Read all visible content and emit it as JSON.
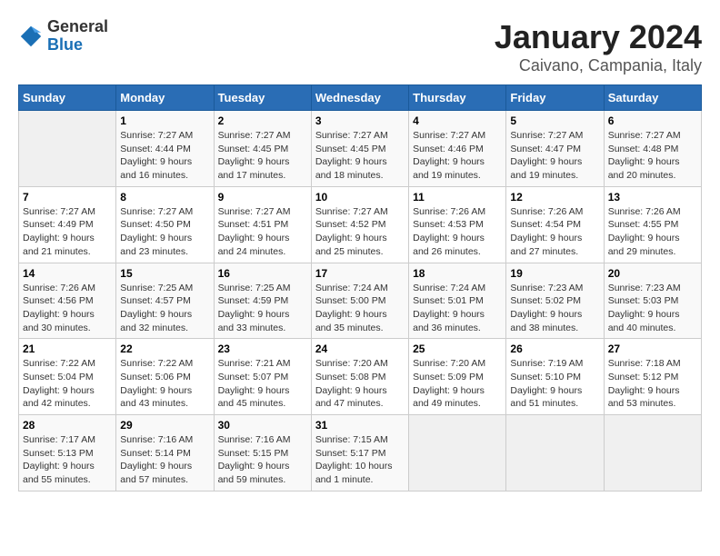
{
  "logo": {
    "general": "General",
    "blue": "Blue"
  },
  "title": "January 2024",
  "subtitle": "Caivano, Campania, Italy",
  "days_of_week": [
    "Sunday",
    "Monday",
    "Tuesday",
    "Wednesday",
    "Thursday",
    "Friday",
    "Saturday"
  ],
  "weeks": [
    [
      {
        "day": "",
        "sunrise": "",
        "sunset": "",
        "daylight": ""
      },
      {
        "day": "1",
        "sunrise": "Sunrise: 7:27 AM",
        "sunset": "Sunset: 4:44 PM",
        "daylight": "Daylight: 9 hours and 16 minutes."
      },
      {
        "day": "2",
        "sunrise": "Sunrise: 7:27 AM",
        "sunset": "Sunset: 4:45 PM",
        "daylight": "Daylight: 9 hours and 17 minutes."
      },
      {
        "day": "3",
        "sunrise": "Sunrise: 7:27 AM",
        "sunset": "Sunset: 4:45 PM",
        "daylight": "Daylight: 9 hours and 18 minutes."
      },
      {
        "day": "4",
        "sunrise": "Sunrise: 7:27 AM",
        "sunset": "Sunset: 4:46 PM",
        "daylight": "Daylight: 9 hours and 19 minutes."
      },
      {
        "day": "5",
        "sunrise": "Sunrise: 7:27 AM",
        "sunset": "Sunset: 4:47 PM",
        "daylight": "Daylight: 9 hours and 19 minutes."
      },
      {
        "day": "6",
        "sunrise": "Sunrise: 7:27 AM",
        "sunset": "Sunset: 4:48 PM",
        "daylight": "Daylight: 9 hours and 20 minutes."
      }
    ],
    [
      {
        "day": "7",
        "sunrise": "Sunrise: 7:27 AM",
        "sunset": "Sunset: 4:49 PM",
        "daylight": "Daylight: 9 hours and 21 minutes."
      },
      {
        "day": "8",
        "sunrise": "Sunrise: 7:27 AM",
        "sunset": "Sunset: 4:50 PM",
        "daylight": "Daylight: 9 hours and 23 minutes."
      },
      {
        "day": "9",
        "sunrise": "Sunrise: 7:27 AM",
        "sunset": "Sunset: 4:51 PM",
        "daylight": "Daylight: 9 hours and 24 minutes."
      },
      {
        "day": "10",
        "sunrise": "Sunrise: 7:27 AM",
        "sunset": "Sunset: 4:52 PM",
        "daylight": "Daylight: 9 hours and 25 minutes."
      },
      {
        "day": "11",
        "sunrise": "Sunrise: 7:26 AM",
        "sunset": "Sunset: 4:53 PM",
        "daylight": "Daylight: 9 hours and 26 minutes."
      },
      {
        "day": "12",
        "sunrise": "Sunrise: 7:26 AM",
        "sunset": "Sunset: 4:54 PM",
        "daylight": "Daylight: 9 hours and 27 minutes."
      },
      {
        "day": "13",
        "sunrise": "Sunrise: 7:26 AM",
        "sunset": "Sunset: 4:55 PM",
        "daylight": "Daylight: 9 hours and 29 minutes."
      }
    ],
    [
      {
        "day": "14",
        "sunrise": "Sunrise: 7:26 AM",
        "sunset": "Sunset: 4:56 PM",
        "daylight": "Daylight: 9 hours and 30 minutes."
      },
      {
        "day": "15",
        "sunrise": "Sunrise: 7:25 AM",
        "sunset": "Sunset: 4:57 PM",
        "daylight": "Daylight: 9 hours and 32 minutes."
      },
      {
        "day": "16",
        "sunrise": "Sunrise: 7:25 AM",
        "sunset": "Sunset: 4:59 PM",
        "daylight": "Daylight: 9 hours and 33 minutes."
      },
      {
        "day": "17",
        "sunrise": "Sunrise: 7:24 AM",
        "sunset": "Sunset: 5:00 PM",
        "daylight": "Daylight: 9 hours and 35 minutes."
      },
      {
        "day": "18",
        "sunrise": "Sunrise: 7:24 AM",
        "sunset": "Sunset: 5:01 PM",
        "daylight": "Daylight: 9 hours and 36 minutes."
      },
      {
        "day": "19",
        "sunrise": "Sunrise: 7:23 AM",
        "sunset": "Sunset: 5:02 PM",
        "daylight": "Daylight: 9 hours and 38 minutes."
      },
      {
        "day": "20",
        "sunrise": "Sunrise: 7:23 AM",
        "sunset": "Sunset: 5:03 PM",
        "daylight": "Daylight: 9 hours and 40 minutes."
      }
    ],
    [
      {
        "day": "21",
        "sunrise": "Sunrise: 7:22 AM",
        "sunset": "Sunset: 5:04 PM",
        "daylight": "Daylight: 9 hours and 42 minutes."
      },
      {
        "day": "22",
        "sunrise": "Sunrise: 7:22 AM",
        "sunset": "Sunset: 5:06 PM",
        "daylight": "Daylight: 9 hours and 43 minutes."
      },
      {
        "day": "23",
        "sunrise": "Sunrise: 7:21 AM",
        "sunset": "Sunset: 5:07 PM",
        "daylight": "Daylight: 9 hours and 45 minutes."
      },
      {
        "day": "24",
        "sunrise": "Sunrise: 7:20 AM",
        "sunset": "Sunset: 5:08 PM",
        "daylight": "Daylight: 9 hours and 47 minutes."
      },
      {
        "day": "25",
        "sunrise": "Sunrise: 7:20 AM",
        "sunset": "Sunset: 5:09 PM",
        "daylight": "Daylight: 9 hours and 49 minutes."
      },
      {
        "day": "26",
        "sunrise": "Sunrise: 7:19 AM",
        "sunset": "Sunset: 5:10 PM",
        "daylight": "Daylight: 9 hours and 51 minutes."
      },
      {
        "day": "27",
        "sunrise": "Sunrise: 7:18 AM",
        "sunset": "Sunset: 5:12 PM",
        "daylight": "Daylight: 9 hours and 53 minutes."
      }
    ],
    [
      {
        "day": "28",
        "sunrise": "Sunrise: 7:17 AM",
        "sunset": "Sunset: 5:13 PM",
        "daylight": "Daylight: 9 hours and 55 minutes."
      },
      {
        "day": "29",
        "sunrise": "Sunrise: 7:16 AM",
        "sunset": "Sunset: 5:14 PM",
        "daylight": "Daylight: 9 hours and 57 minutes."
      },
      {
        "day": "30",
        "sunrise": "Sunrise: 7:16 AM",
        "sunset": "Sunset: 5:15 PM",
        "daylight": "Daylight: 9 hours and 59 minutes."
      },
      {
        "day": "31",
        "sunrise": "Sunrise: 7:15 AM",
        "sunset": "Sunset: 5:17 PM",
        "daylight": "Daylight: 10 hours and 1 minute."
      },
      {
        "day": "",
        "sunrise": "",
        "sunset": "",
        "daylight": ""
      },
      {
        "day": "",
        "sunrise": "",
        "sunset": "",
        "daylight": ""
      },
      {
        "day": "",
        "sunrise": "",
        "sunset": "",
        "daylight": ""
      }
    ]
  ]
}
